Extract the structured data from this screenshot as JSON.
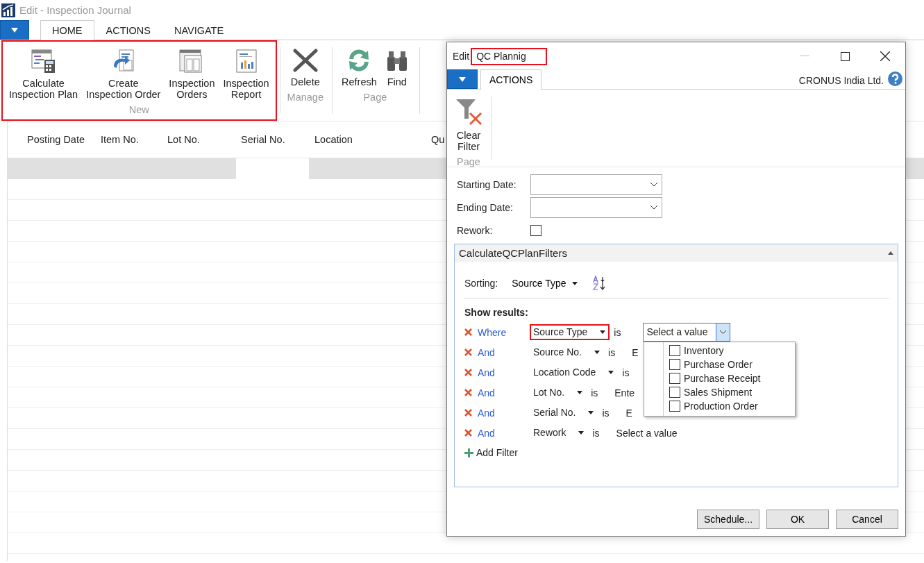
{
  "window": {
    "title": "Edit - Inspection Journal"
  },
  "tabs": [
    {
      "label": "HOME",
      "selected": true
    },
    {
      "label": "ACTIONS",
      "selected": false
    },
    {
      "label": "NAVIGATE",
      "selected": false
    }
  ],
  "ribbon_groups": [
    {
      "label": "New",
      "highlighted": true,
      "actions": [
        {
          "label": "Calculate\nInspection Plan",
          "kind": "plan"
        },
        {
          "label": "Create\nInspection Order",
          "kind": "create-order"
        },
        {
          "label": "Inspection\nOrders",
          "kind": "orders"
        },
        {
          "label": "Inspection\nReport",
          "kind": "report"
        }
      ]
    },
    {
      "label": "Manage",
      "highlighted": false,
      "actions": [
        {
          "label": "Delete",
          "kind": "delete"
        }
      ]
    },
    {
      "label": "Page",
      "highlighted": false,
      "actions": [
        {
          "label": "Refresh",
          "kind": "refresh"
        },
        {
          "label": "Find",
          "kind": "find"
        }
      ]
    }
  ],
  "table": {
    "columns": [
      "Posting Date",
      "Item No.",
      "Lot No.",
      "Serial No.",
      "Location",
      "Qu"
    ]
  },
  "dialog": {
    "title_prefix": "Edit",
    "title": "QC Plannig",
    "title_highlighted": true,
    "tabs": [
      {
        "label": "ACTIONS",
        "selected": true
      }
    ],
    "company": "CRONUS India Ltd.",
    "ribbon_groups": [
      {
        "label": "Page",
        "actions": [
          {
            "label": "Clear\nFilter",
            "kind": "clear-filter"
          }
        ]
      }
    ],
    "fields": [
      {
        "label": "Starting Date:",
        "kind": "date"
      },
      {
        "label": "Ending Date:",
        "kind": "date"
      },
      {
        "label": "Rework:",
        "kind": "checkbox",
        "checked": false
      }
    ],
    "filters_panel": {
      "title": "CalculateQCPlanFilters",
      "expanded": true,
      "sorting_label": "Sorting:",
      "sort_field": "Source Type",
      "show_results": "Show results:",
      "filters": [
        {
          "conjunction": "Where",
          "field": "Source Type",
          "operator": "is",
          "value": "Select a value",
          "kind": "select",
          "highlighted": true
        },
        {
          "conjunction": "And",
          "field": "Source No.",
          "operator": "is",
          "value": "E",
          "kind": "text",
          "highlighted": false
        },
        {
          "conjunction": "And",
          "field": "Location Code",
          "operator": "is",
          "kind": "text",
          "highlighted": false
        },
        {
          "conjunction": "And",
          "field": "Lot No.",
          "operator": "is",
          "value": "Ente",
          "kind": "text",
          "highlighted": false
        },
        {
          "conjunction": "And",
          "field": "Serial No.",
          "operator": "is",
          "value": "E",
          "kind": "text",
          "highlighted": false
        },
        {
          "conjunction": "And",
          "field": "Rework",
          "operator": "is",
          "value": "Select a value",
          "kind": "text",
          "highlighted": false
        }
      ],
      "options": [
        {
          "label": "Inventory",
          "checked": false
        },
        {
          "label": "Purchase Order",
          "checked": false
        },
        {
          "label": "Purchase Receipt",
          "checked": false
        },
        {
          "label": "Sales Shipment",
          "checked": false
        },
        {
          "label": "Production Order",
          "checked": false
        }
      ],
      "add_filter": "Add Filter"
    },
    "buttons": [
      "Schedule...",
      "OK",
      "Cancel"
    ]
  }
}
